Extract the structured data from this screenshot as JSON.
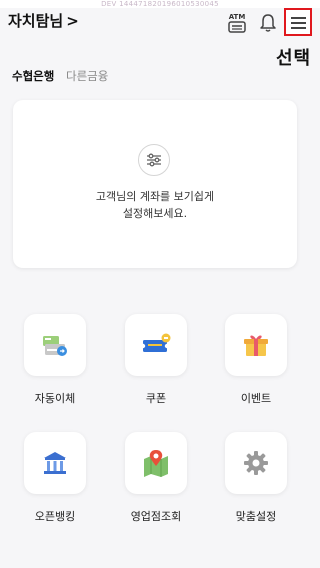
{
  "header": {
    "top_strip": "DEV 144471820196010530045",
    "brand": "자치탐님",
    "brand_chevron": ">",
    "atm_text": "ATM",
    "select_label": "선택"
  },
  "bank_tabs": [
    {
      "label": "수협은행",
      "active": true
    },
    {
      "label": "다른금융",
      "active": false
    }
  ],
  "account_card": {
    "message_line1": "고객님의 계좌를 보기쉽게",
    "message_line2": "설정해보세요."
  },
  "menu_tiles": [
    {
      "label": "자동이체",
      "icon": "auto-transfer-icon"
    },
    {
      "label": "쿠폰",
      "icon": "coupon-icon"
    },
    {
      "label": "이벤트",
      "icon": "gift-icon"
    },
    {
      "label": "오픈뱅킹",
      "icon": "bank-building-icon"
    },
    {
      "label": "영업점조회",
      "icon": "map-pin-icon"
    },
    {
      "label": "맞춤설정",
      "icon": "gear-icon"
    }
  ],
  "colors": {
    "highlight_red": "#e0181e",
    "background": "#f6f6f8"
  }
}
